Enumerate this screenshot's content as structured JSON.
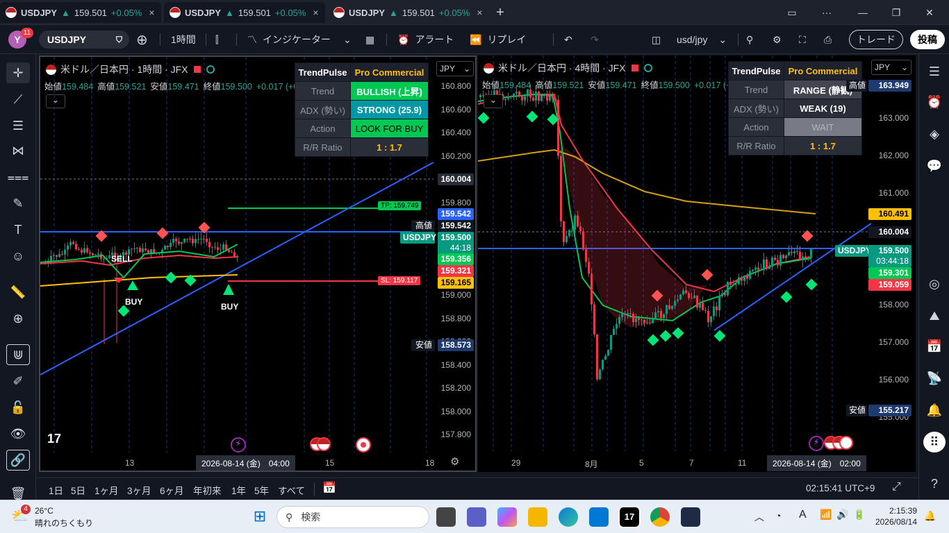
{
  "tabs": [
    {
      "symbol": "USDJPY",
      "price": "159.501",
      "change": "+0.05%"
    },
    {
      "symbol": "USDJPY",
      "price": "159.501",
      "change": "+0.05%"
    },
    {
      "symbol": "USDJPY",
      "price": "159.501",
      "change": "+0.05%"
    }
  ],
  "toolbar": {
    "avatar": "Y",
    "notif": "11",
    "symbol": "USDJPY",
    "interval": "1時間",
    "indicators": "インジケーター",
    "alert": "アラート",
    "replay": "リプレイ",
    "layout": "usd/jpy",
    "trade": "トレード",
    "publish": "投稿"
  },
  "left_chart": {
    "title": "米ドル／日本円 · 1時間 · JFX",
    "ohlc": {
      "o_k": "始値",
      "o": "159.484",
      "h_k": "高値",
      "h": "159.521",
      "l_k": "安値",
      "l": "159.471",
      "c_k": "終値",
      "c": "159.500",
      "chg": "+0.017 (+0.01%)"
    },
    "currency": "JPY",
    "table": {
      "h1": "TrendPulse",
      "h2": "Pro Commercial",
      "rows": [
        [
          "Trend",
          "BULLISH (上昇)"
        ],
        [
          "ADX (勢い)",
          "STRONG (25.9)"
        ],
        [
          "Action",
          "LOOK FOR BUY"
        ],
        [
          "R/R Ratio",
          "1 : 1.7"
        ]
      ]
    },
    "prices": [
      "160.800",
      "160.600",
      "160.400",
      "160.200",
      "159.800",
      "159.000",
      "158.800",
      "158.600",
      "158.400",
      "158.200",
      "158.000",
      "157.800"
    ],
    "tags": {
      "t1": "160.004",
      "t2": "159.542",
      "high_k": "高値",
      "high": "159.542",
      "sym": "USDJPY",
      "cur": "159.500",
      "cd": "44:18",
      "g": "159.356",
      "r": "159.321",
      "y": "159.165",
      "low_k": "安値",
      "low": "158.573"
    },
    "tp": "TP: 159.749",
    "sl": "SL: 159.117",
    "labels": {
      "sell": "SELL",
      "buy1": "BUY",
      "buy2": "BUY"
    },
    "time": {
      "t1": "13",
      "t2": "2026-08-14 (金)　04:00",
      "t3": "15",
      "t4": "18"
    }
  },
  "right_chart": {
    "title": "米ドル／日本円 · 4時間 · JFX",
    "ohlc": {
      "o_k": "始値",
      "o": "159.484",
      "h_k": "高値",
      "h": "159.521",
      "l_k": "安値",
      "l": "159.471",
      "c_k": "終値",
      "c": "159.500",
      "chg": "+0.017 (+0.01%)"
    },
    "currency": "JPY",
    "table": {
      "h1": "TrendPulse",
      "h2": "Pro Commercial",
      "rows": [
        [
          "Trend",
          "RANGE (静観)"
        ],
        [
          "ADX (勢い)",
          "WEAK (19)"
        ],
        [
          "Action",
          "WAIT"
        ],
        [
          "R/R Ratio",
          "1 : 1.7"
        ]
      ]
    },
    "prices": [
      "163.000",
      "162.000",
      "161.000",
      "158.000",
      "157.000",
      "156.000",
      "155.000"
    ],
    "tags": {
      "high_k": "高値",
      "high": "163.949",
      "y": "160.491",
      "w": "160.004",
      "sym": "USDJPY",
      "cur": "159.500",
      "cd": "03:44:18",
      "g": "159.301",
      "r": "159.059",
      "low_k": "安値",
      "low": "155.217"
    },
    "time": {
      "t1": "29",
      "t2": "8月",
      "t3": "5",
      "t4": "7",
      "t5": "11",
      "t6": "2026-08-14 (金)　02:00"
    }
  },
  "bottom": {
    "ranges": [
      "1日",
      "5日",
      "1ヶ月",
      "3ヶ月",
      "6ヶ月",
      "年初来",
      "1年",
      "5年",
      "すべて"
    ],
    "clock": "02:15:41 UTC+9"
  },
  "taskbar": {
    "temp": "26°C",
    "weather": "晴れのちくもり",
    "search": "検索",
    "time": "2:15:39",
    "date": "2026/08/14",
    "badge": "4"
  }
}
